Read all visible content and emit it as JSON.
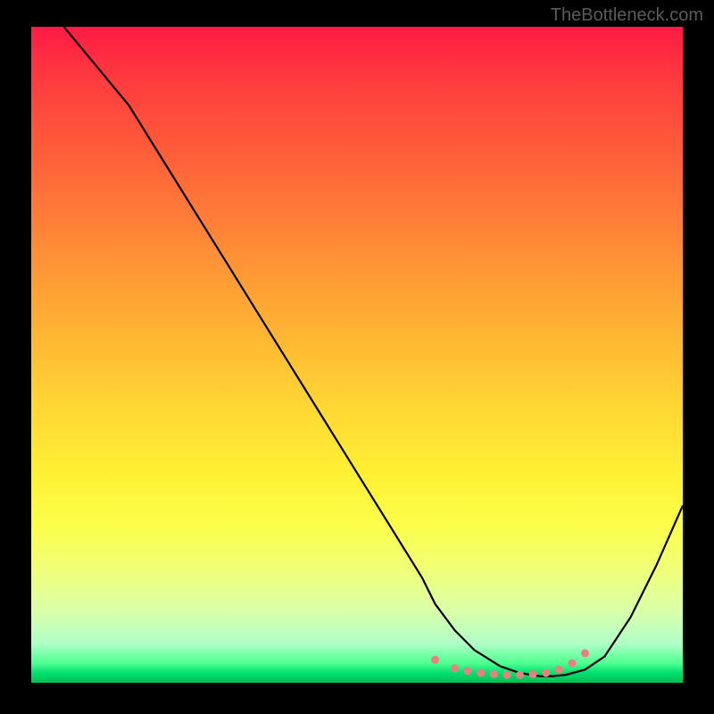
{
  "watermark": "TheBottleneck.com",
  "chart_data": {
    "type": "line",
    "title": "",
    "xlabel": "",
    "ylabel": "",
    "xlim": [
      0,
      100
    ],
    "ylim": [
      0,
      100
    ],
    "series": [
      {
        "name": "curve",
        "x": [
          5,
          10,
          15,
          20,
          25,
          30,
          35,
          40,
          45,
          50,
          55,
          60,
          62,
          65,
          68,
          72,
          75,
          78,
          80,
          82,
          85,
          88,
          92,
          96,
          100
        ],
        "y": [
          100,
          94,
          88,
          80,
          72,
          64,
          56,
          48,
          40,
          32,
          24,
          16,
          12,
          8,
          5,
          2.5,
          1.5,
          1,
          1,
          1.2,
          2,
          4,
          10,
          18,
          27
        ]
      }
    ],
    "markers": {
      "name": "bottom-dots",
      "x": [
        62,
        65,
        67,
        69,
        71,
        73,
        75,
        77,
        79,
        81,
        83,
        85
      ],
      "y": [
        3.5,
        2.2,
        1.8,
        1.5,
        1.3,
        1.2,
        1.2,
        1.3,
        1.5,
        2.0,
        3.0,
        4.5
      ]
    },
    "gradient_stops": [
      {
        "pos": 0,
        "color": "#ff1a44"
      },
      {
        "pos": 50,
        "color": "#ffd733"
      },
      {
        "pos": 80,
        "color": "#fbff4a"
      },
      {
        "pos": 100,
        "color": "#00c050"
      }
    ]
  }
}
